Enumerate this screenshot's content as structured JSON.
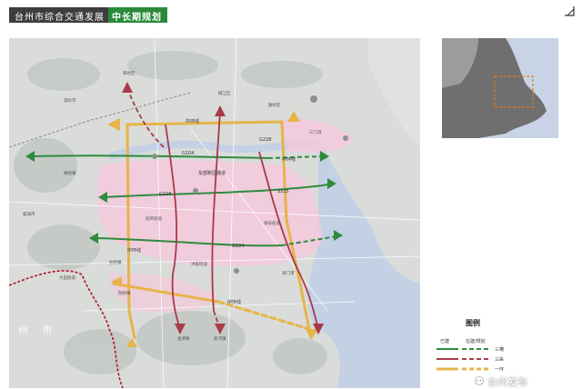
{
  "header": {
    "title": "台州市综合交通发展",
    "highlight": "中长期规划"
  },
  "map": {
    "region_label": "州 市",
    "road_labels": [
      "G228",
      "G104",
      "G228",
      "G104",
      "S325",
      "东部新区通道",
      "中环线",
      "中环线",
      "中环线",
      "中环线"
    ],
    "place_labels": [
      "黄岩区",
      "椒江区",
      "路桥区",
      "温岭市",
      "临海市",
      "杜桥镇",
      "大田街道",
      "金清镇",
      "新河镇",
      "院桥镇",
      "三门湾",
      "前所街道",
      "章安街道",
      "洪家街道",
      "横街镇",
      "海门港"
    ]
  },
  "legend": {
    "title": "图例",
    "col_existing": "已建",
    "col_planned": "在建/规划",
    "rows": [
      {
        "label": "三横",
        "color": "#2e8b3e"
      },
      {
        "label": "三纵",
        "color": "#a83a4a"
      },
      {
        "label": "一环",
        "color": "#e6b448"
      }
    ]
  },
  "watermark": "台州发布",
  "colors": {
    "horizontal": "#2e8b3e",
    "vertical": "#a83a4a",
    "ring": "#e6b448",
    "urban": "#f3c9dc",
    "sea": "#c4d0e4"
  },
  "icons": [
    "frame-corner-icon",
    "wechat-icon"
  ]
}
